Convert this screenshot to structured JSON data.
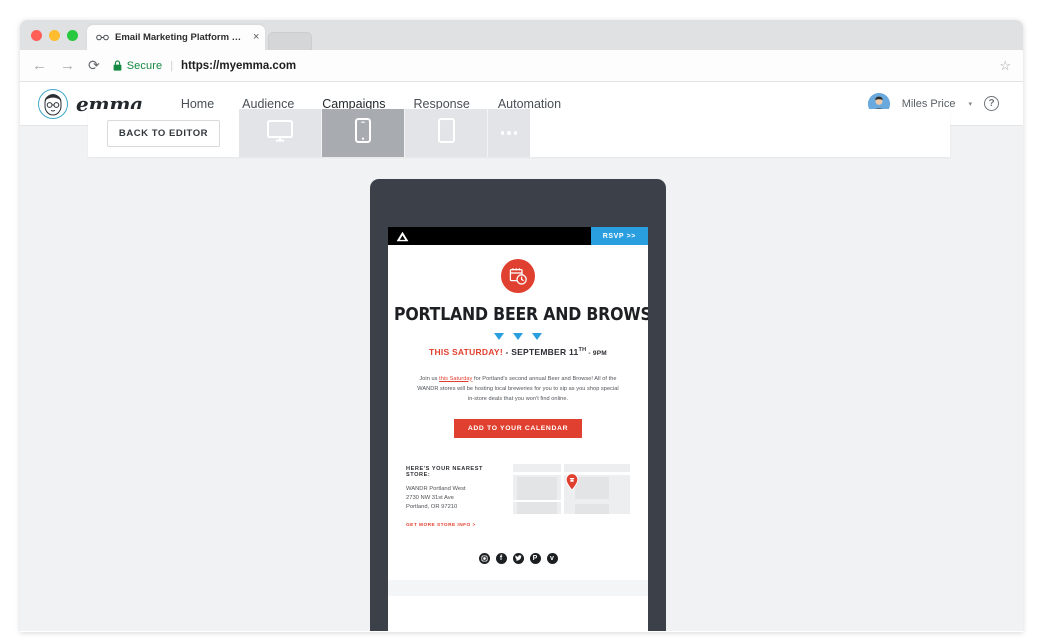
{
  "browser": {
    "tab": {
      "title": "Email Marketing Platform and ",
      "favicon_name": "glasses-favicon",
      "close_label": "×"
    },
    "nav": {
      "back": "←",
      "forward": "→",
      "reload": "⟳",
      "bookmark": "☆"
    },
    "address": {
      "lock_icon": "lock-icon",
      "secure_label": "Secure",
      "separator": "|",
      "url": "https://myemma.com"
    }
  },
  "app": {
    "brand": {
      "name": "emma",
      "mark_name": "emma-avatar-logo"
    },
    "nav_links": [
      {
        "label": "Home",
        "active": false
      },
      {
        "label": "Audience",
        "active": false
      },
      {
        "label": "Campaigns",
        "active": true
      },
      {
        "label": "Response",
        "active": false
      },
      {
        "label": "Automation",
        "active": false
      }
    ],
    "account": {
      "user_name": "Miles Price",
      "caret": "▾",
      "help_label": "?"
    }
  },
  "preview_toolbar": {
    "back_label": "BACK TO EDITOR",
    "devices": [
      {
        "name": "desktop",
        "icon": "desktop-monitor-icon",
        "active": false
      },
      {
        "name": "mobile",
        "icon": "mobile-phone-icon",
        "active": true
      },
      {
        "name": "tablet",
        "icon": "tablet-icon",
        "active": false
      }
    ],
    "more_label": "…"
  },
  "email": {
    "top_bar": {
      "logo_name": "wandr-mountain-logo",
      "rsvp_label": "RSVP >>"
    },
    "badge_icon": "calendar-clock-badge",
    "headline": "PORTLAND BEER AND BROWSE",
    "dateline": {
      "highlight": "THIS SATURDAY!",
      "separator": " - SEPTEMBER 11",
      "ordinal": "TH",
      "time": " - 9PM"
    },
    "paragraph": {
      "before_link": "Join us ",
      "link": "this Saturday",
      "after_link": " for Portland's second annual Beer and Browse! All of the WANDR stores will be hosting local breweries for you to sip as you shop special in-store deals that you won't find online."
    },
    "cta_label": "ADD TO YOUR CALENDAR",
    "store": {
      "title": "HERE'S YOUR NEAREST STORE:",
      "name": "WANDR Portland West",
      "street": "2730 NW 31st Ave",
      "city_state_zip": "Portland, OR 97210",
      "link_label": "GET MORE STORE INFO >",
      "map_pin_name": "map-location-pin"
    },
    "social": [
      {
        "name": "instagram",
        "glyph": "◉"
      },
      {
        "name": "facebook",
        "glyph": "f"
      },
      {
        "name": "twitter",
        "glyph": "ᵗ"
      },
      {
        "name": "pinterest",
        "glyph": "P"
      },
      {
        "name": "vimeo",
        "glyph": "v"
      }
    ]
  },
  "colors": {
    "accent_blue": "#2a9fe0",
    "brand_teal": "#3ea8c8",
    "email_red": "#e0402f",
    "phone_frame": "#3b4049",
    "page_bg": "#f1f2f4"
  }
}
